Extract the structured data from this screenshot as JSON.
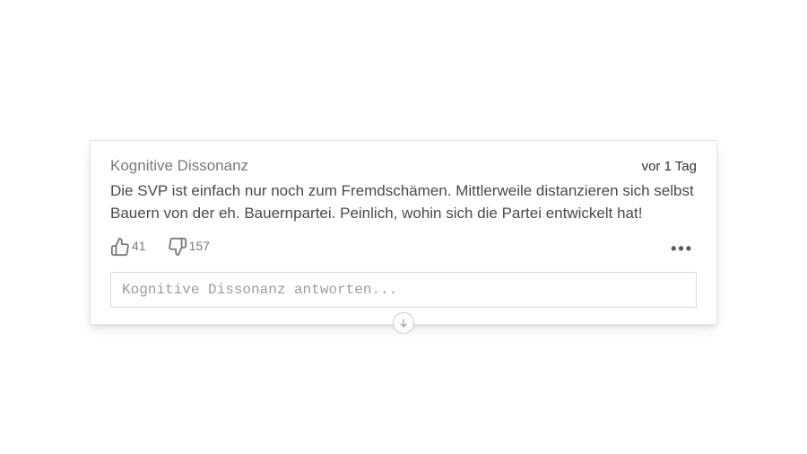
{
  "comment": {
    "author": "Kognitive Dissonanz",
    "timestamp": "vor 1 Tag",
    "body": "Die SVP ist einfach nur noch zum Fremdschämen. Mittlerweile distanzieren sich selbst Bauern von der eh. Bauernpartei. Peinlich, wohin sich die Partei entwickelt hat!",
    "likes": "41",
    "dislikes": "157",
    "more_label": "•••",
    "reply_placeholder": "Kognitive Dissonanz antworten..."
  }
}
